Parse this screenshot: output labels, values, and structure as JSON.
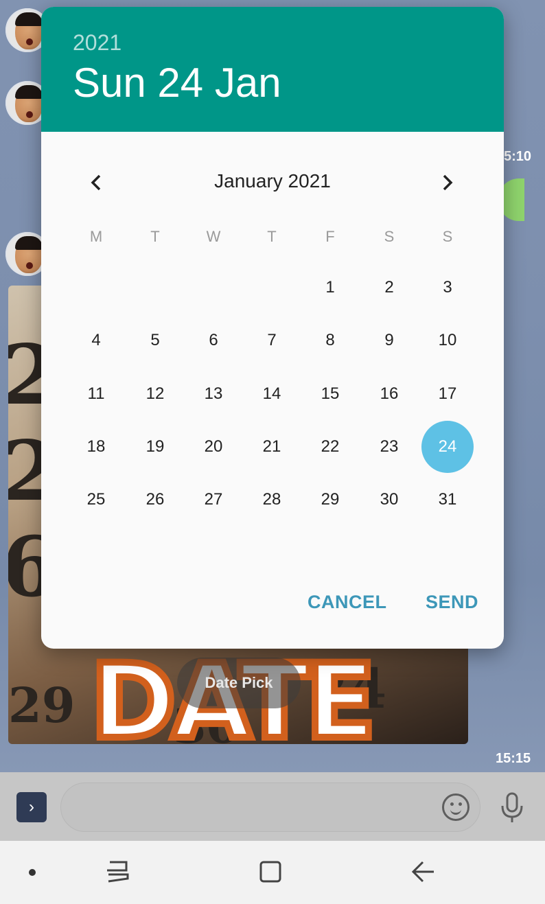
{
  "chat": {
    "times": [
      "5:10",
      "15:15"
    ],
    "image_caption": "Date Pick",
    "image_numbers": [
      "21",
      "2",
      "6",
      "24",
      "29",
      "30"
    ],
    "image_word": "DATE"
  },
  "dialog": {
    "header_year": "2021",
    "header_date": "Sun 24 Jan",
    "month_label": "January 2021",
    "weekdays": [
      "M",
      "T",
      "W",
      "T",
      "F",
      "S",
      "S"
    ],
    "weeks": [
      [
        "",
        "",
        "",
        "",
        "1",
        "2",
        "3"
      ],
      [
        "4",
        "5",
        "6",
        "7",
        "8",
        "9",
        "10"
      ],
      [
        "11",
        "12",
        "13",
        "14",
        "15",
        "16",
        "17"
      ],
      [
        "18",
        "19",
        "20",
        "21",
        "22",
        "23",
        "24"
      ],
      [
        "25",
        "26",
        "27",
        "28",
        "29",
        "30",
        "31"
      ]
    ],
    "selected_day": "24",
    "cancel_label": "CANCEL",
    "send_label": "SEND",
    "colors": {
      "header": "#009688",
      "selected": "#5ec1e5",
      "action": "#3d97b8"
    }
  },
  "input_bar": {
    "expand_icon": "chevron-right-icon",
    "emoji_icon": "smiley-icon",
    "mic_icon": "microphone-icon"
  },
  "nav": {
    "icons": [
      "dot-icon",
      "recents-icon",
      "home-icon",
      "back-icon"
    ]
  }
}
